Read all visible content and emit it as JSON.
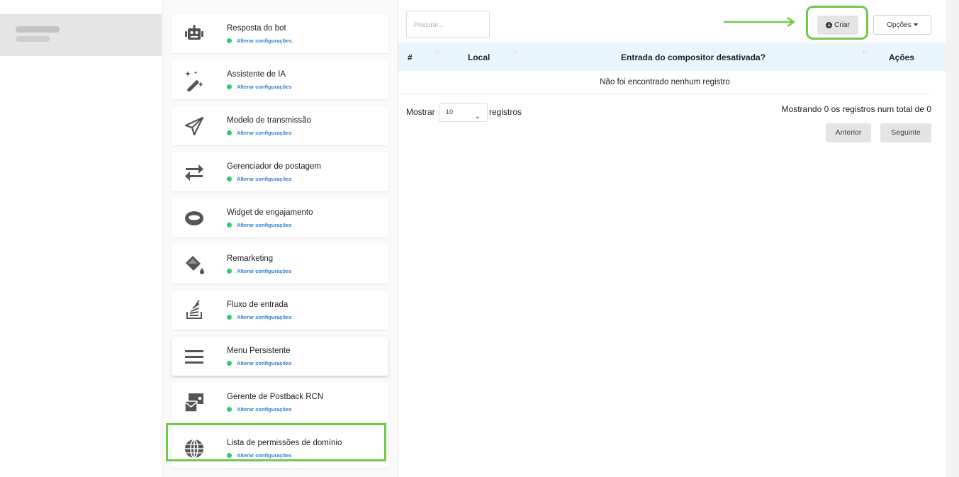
{
  "sidebar": {
    "items": [
      {
        "title": "Resposta do bot",
        "status": "Alterar configurações",
        "icon": "robot-icon"
      },
      {
        "title": "Assistente de IA",
        "status": "Alterar configurações",
        "icon": "magic-wand-icon"
      },
      {
        "title": "Modelo de transmissão",
        "status": "Alterar configurações",
        "icon": "paper-plane-icon"
      },
      {
        "title": "Gerenciador de postagem",
        "status": "Alterar configurações",
        "icon": "exchange-arrows-icon"
      },
      {
        "title": "Widget de engajamento",
        "status": "Alterar configurações",
        "icon": "ring-icon"
      },
      {
        "title": "Remarketing",
        "status": "Alterar configurações",
        "icon": "paint-bucket-icon"
      },
      {
        "title": "Fluxo de entrada",
        "status": "Alterar configurações",
        "icon": "stack-icon"
      },
      {
        "title": "Menu Persistente",
        "status": "Alterar configurações",
        "icon": "menu-bars-icon"
      },
      {
        "title": "Gerente de Postback RCN",
        "status": "Alterar configurações",
        "icon": "mail-box-icon"
      },
      {
        "title": "Lista de permissões de domínio",
        "status": "Alterar configurações",
        "icon": "globe-icon"
      }
    ]
  },
  "toolbar": {
    "search_placeholder": "Procurar...",
    "create_label": "Criar",
    "options_label": "Opções"
  },
  "table": {
    "columns": [
      "#",
      "Local",
      "Entrada do compositor desativada?",
      "Ações"
    ],
    "empty_message": "Não foi encontrado nenhum registro"
  },
  "pagination": {
    "show_label": "Mostrar",
    "page_length": "10",
    "records_label": "registros",
    "info": "Mostrando 0 os registros num total de 0",
    "previous_label": "Anterior",
    "next_label": "Seguinte"
  },
  "colors": {
    "highlight": "#72c94a",
    "status_dot": "#2ecc71",
    "status_link": "#2f80d1",
    "table_header_bg": "#eaf6fd"
  }
}
